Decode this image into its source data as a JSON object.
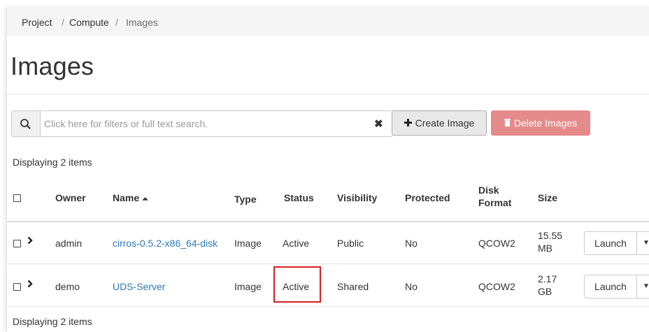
{
  "breadcrumb": {
    "items": [
      "Project",
      "Compute",
      "Images"
    ],
    "separator": "/"
  },
  "page_title": "Images",
  "search": {
    "placeholder": "Click here for filters or full text search.",
    "value": "",
    "clear_glyph": "✖"
  },
  "actions": {
    "create_label": "Create Image",
    "delete_label": "Delete Images"
  },
  "count_text_top": "Displaying 2 items",
  "count_text_bottom": "Displaying 2 items",
  "table": {
    "headers": {
      "owner": "Owner",
      "name": "Name",
      "sort_indicator": "⏶",
      "type": "Type",
      "status": "Status",
      "visibility": "Visibility",
      "protected": "Protected",
      "disk_format_1": "Disk",
      "disk_format_2": "Format",
      "size": "Size"
    },
    "rows": [
      {
        "owner": "admin",
        "name": "cirros-0.5.2-x86_64-disk",
        "type": "Image",
        "status": "Active",
        "visibility": "Public",
        "protected": "No",
        "disk_format": "QCOW2",
        "size_1": "15.55",
        "size_2": "MB",
        "action": "Launch"
      },
      {
        "owner": "demo",
        "name": "UDS-Server",
        "type": "Image",
        "status": "Active",
        "visibility": "Shared",
        "protected": "No",
        "disk_format": "QCOW2",
        "size_1": "2.17",
        "size_2": "GB",
        "action": "Launch"
      }
    ]
  },
  "colors": {
    "link": "#2a7ab8",
    "danger_button": "#e48a8a",
    "highlight_box": "#d02020"
  },
  "icons": {
    "search": "search-icon",
    "clear": "close-icon",
    "create": "plus-icon",
    "delete": "trash-icon",
    "expand": "chevron-right-icon",
    "dropdown": "caret-down-icon"
  }
}
